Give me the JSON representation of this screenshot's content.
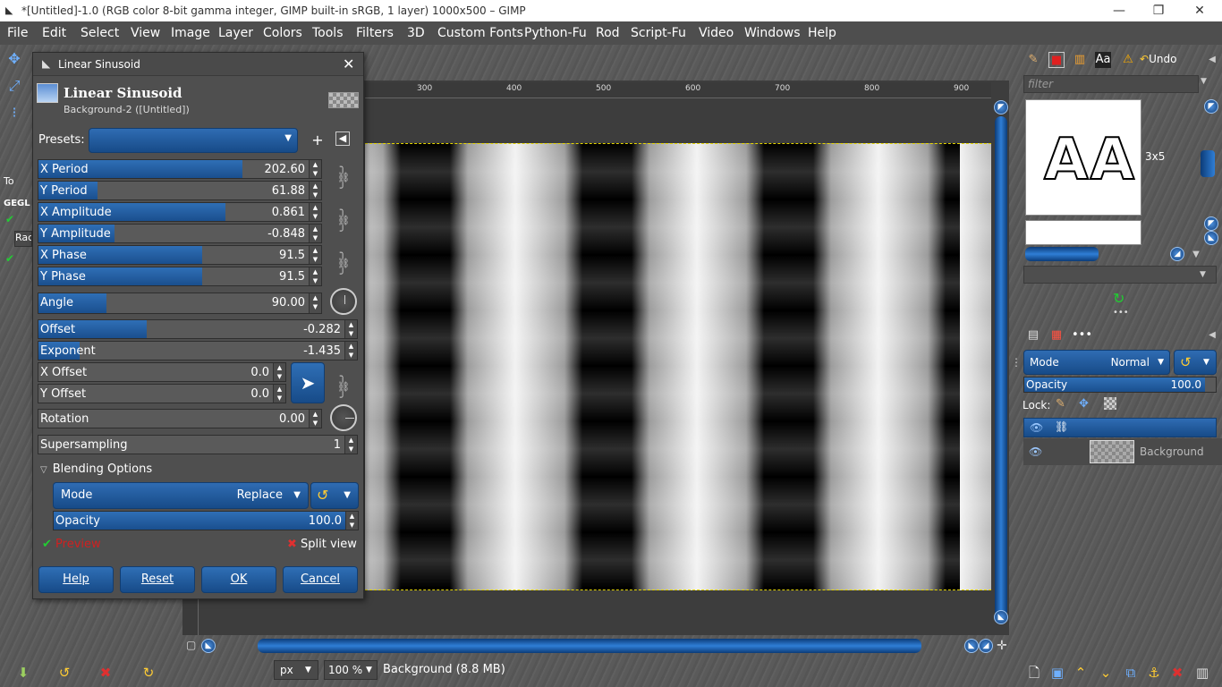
{
  "window": {
    "title": "*[Untitled]-1.0 (RGB color 8-bit gamma integer, GIMP built-in sRGB, 1 layer) 1000x500 – GIMP",
    "minimize": "—",
    "restore": "❐",
    "close": "✕"
  },
  "menu": [
    "File",
    "Edit",
    "Select",
    "View",
    "Image",
    "Layer",
    "Colors",
    "Tools",
    "Filters",
    "3D",
    "Custom Fonts",
    "Python-Fu",
    "Rod",
    "Script-Fu",
    "Video",
    "Windows",
    "Help"
  ],
  "ruler": {
    "ticks": [
      "300",
      "400",
      "500",
      "600",
      "700",
      "800",
      "900"
    ]
  },
  "left_panel": {
    "tab_label": "To",
    "gegl_label": "GEGL",
    "field_text": "Rac"
  },
  "dialog": {
    "title": "Linear Sinusoid",
    "close": "✕",
    "header_title": "Linear Sinusoid",
    "header_subtitle": "Background-2 ([Untitled])",
    "presets_label": "Presets:",
    "add": "+",
    "params": [
      {
        "label": "X Period",
        "value": "202.60",
        "fill": 0.72
      },
      {
        "label": "Y Period",
        "value": "61.88",
        "fill": 0.21
      },
      {
        "label": "X Amplitude",
        "value": "0.861",
        "fill": 0.66
      },
      {
        "label": "Y Amplitude",
        "value": "-0.848",
        "fill": 0.27
      },
      {
        "label": "X Phase",
        "value": "91.5",
        "fill": 0.58
      },
      {
        "label": "Y Phase",
        "value": "91.5",
        "fill": 0.58
      }
    ],
    "angle": {
      "label": "Angle",
      "value": "90.00",
      "fill": 0.24
    },
    "offset": {
      "label": "Offset",
      "value": "-0.282",
      "fill": 0.34
    },
    "exponent": {
      "label": "Exponent",
      "value": "-1.435",
      "fill": 0.13
    },
    "x_offset": {
      "label": "X Offset",
      "value": "0.0",
      "fill": 0.0
    },
    "y_offset": {
      "label": "Y Offset",
      "value": "0.0",
      "fill": 0.0
    },
    "rotation": {
      "label": "Rotation",
      "value": "0.00",
      "fill": 0.0
    },
    "supersampling": {
      "label": "Supersampling",
      "value": "1",
      "fill": 0.0
    },
    "blending_label": "Blending Options",
    "mode_label": "Mode",
    "mode_value": "Replace",
    "opacity_label": "Opacity",
    "opacity_value": "100.0",
    "preview_label": "Preview",
    "split_view_label": "Split view",
    "buttons": {
      "help": "Help",
      "reset": "Reset",
      "ok": "OK",
      "cancel": "Cancel"
    }
  },
  "right_dock": {
    "undo_label": "Undo",
    "filter_placeholder": "filter",
    "brush_text": "AA",
    "brush_size": "3x5",
    "layer_mode_label": "Mode",
    "layer_mode_value": "Normal",
    "layer_opacity_label": "Opacity",
    "layer_opacity_value": "100.0",
    "lock_label": "Lock:",
    "layer_name": "Background"
  },
  "status": {
    "unit": "px",
    "zoom": "100 %",
    "text": "Background (8.8 MB)"
  },
  "colors": {
    "accent": "#1f5ea8",
    "preview_red": "#d02020",
    "check_green": "#22cc33"
  }
}
